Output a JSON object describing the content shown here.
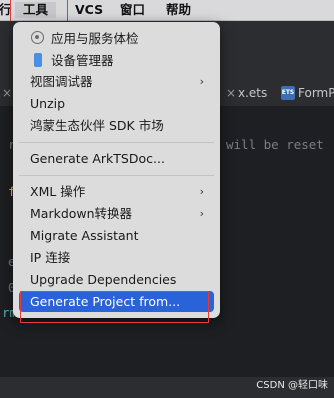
{
  "menubar": {
    "items": [
      "行",
      "工具",
      "VCS",
      "窗口",
      "帮助"
    ]
  },
  "tabs": {
    "x_glyph": "×",
    "file_1": "x.ets",
    "icon_text": "ETS",
    "file_2": "FormPr"
  },
  "editor": {
    "line_1": "r",
    "line_1_comment": "will be reset",
    "line_2": "f",
    "line_3": "e",
    "line_4": "0",
    "line_5": "rm"
  },
  "menu": {
    "items": [
      {
        "label": "应用与服务体检",
        "icon": "harmony-icon",
        "submenu": false
      },
      {
        "label": "设备管理器",
        "icon": "phone-icon",
        "submenu": false
      },
      {
        "label": "视图调试器",
        "submenu": true
      },
      {
        "label": "Unzip",
        "submenu": false
      },
      {
        "label": "鸿蒙生态伙伴 SDK 市场",
        "submenu": false
      },
      {
        "label": "Generate ArkTSDoc...",
        "submenu": false
      },
      {
        "label": "XML 操作",
        "submenu": true
      },
      {
        "label": "Markdown转换器",
        "submenu": true
      },
      {
        "label": "Migrate Assistant",
        "submenu": false
      },
      {
        "label": "IP 连接",
        "submenu": false
      },
      {
        "label": "Upgrade Dependencies",
        "submenu": false
      },
      {
        "label": "Generate Project from...",
        "submenu": false,
        "selected": true
      }
    ],
    "arrow_glyph": "›"
  },
  "watermark": "CSDN @轻口味",
  "colors": {
    "highlight_red": "#e23b3b",
    "selection_blue": "#2962d9",
    "menu_bg": "#dcdcdd"
  }
}
